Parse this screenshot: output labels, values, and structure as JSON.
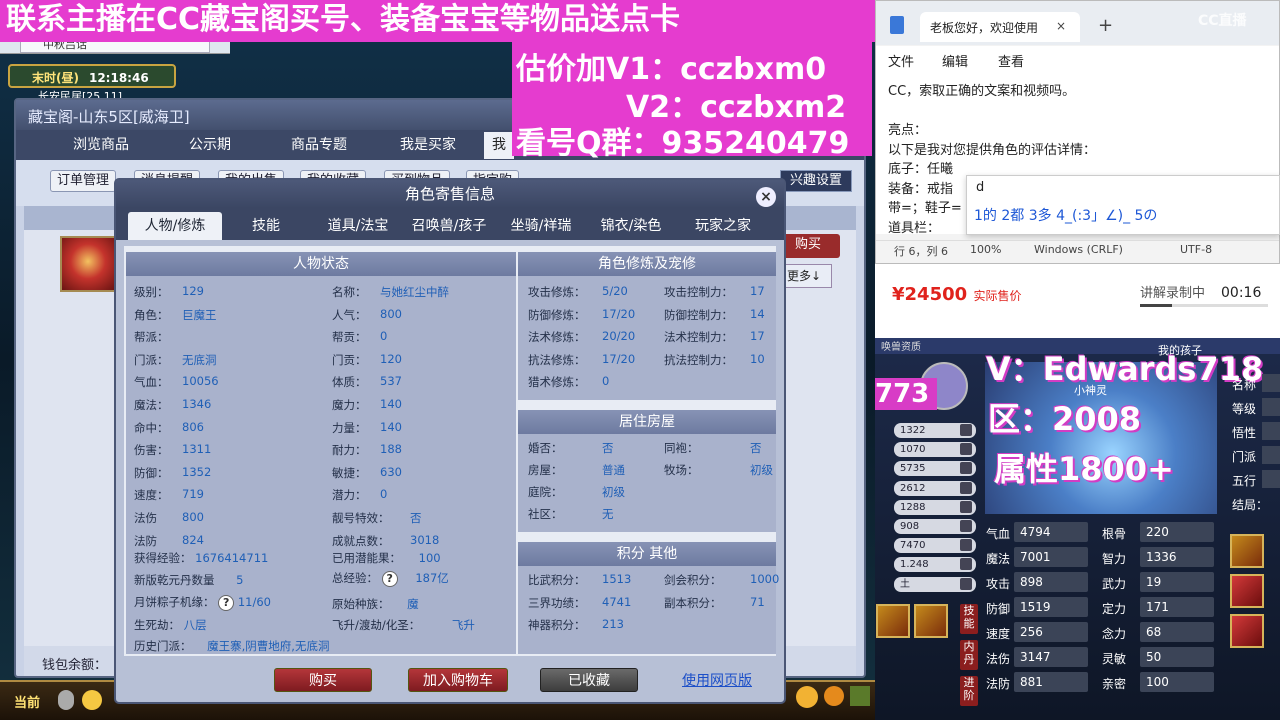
{
  "overlay": {
    "banner_top": "联系主播在CC藏宝阁买号、装备宝宝等物品送点卡",
    "line_v1": "估价加V1：cczbxm0",
    "line_v2": "V2：cczbxm2",
    "line_qq": "看号Q群：935240479"
  },
  "game": {
    "tab_label": "中秋吕话",
    "clock_label": "末时(昼)",
    "clock_time": "12:18:46",
    "map_name": "长安民居[25,11]",
    "current_label": "当前"
  },
  "treasure": {
    "title": "藏宝阁-山东5区[威海卫]",
    "tabs": [
      "浏览商品",
      "公示期",
      "商品专题",
      "我是买家",
      "我"
    ],
    "sub_buttons": [
      "订单管理",
      "消息提醒",
      "我的出售",
      "我的收藏",
      "买到物品",
      "指定购"
    ],
    "fav_settings": "兴趣设置",
    "side_buy": "购买",
    "side_more": "更多↓",
    "wallet_label": "钱包余额："
  },
  "role_dialog": {
    "title": "角色寄售信息",
    "tabs": [
      "人物/修炼",
      "技能",
      "道具/法宝",
      "召唤兽/孩子",
      "坐骑/祥瑞",
      "锦衣/染色",
      "玩家之家"
    ],
    "status_title": "人物状态",
    "status_left": [
      {
        "k": "级别：",
        "v": "129"
      },
      {
        "k": "角色：",
        "v": "巨魔王"
      },
      {
        "k": "帮派：",
        "v": ""
      },
      {
        "k": "门派：",
        "v": "无底洞"
      },
      {
        "k": "气血：",
        "v": "10056"
      },
      {
        "k": "魔法：",
        "v": "1346"
      },
      {
        "k": "命中：",
        "v": "806"
      },
      {
        "k": "伤害：",
        "v": "1311"
      },
      {
        "k": "防御：",
        "v": "1352"
      },
      {
        "k": "速度：",
        "v": "719"
      },
      {
        "k": "法伤",
        "v": "800"
      },
      {
        "k": "法防",
        "v": "824"
      }
    ],
    "status_right": [
      {
        "k": "名称：",
        "v": "与她红尘中醉"
      },
      {
        "k": "人气：",
        "v": "800"
      },
      {
        "k": "帮贡：",
        "v": "0"
      },
      {
        "k": "门贡：",
        "v": "120"
      },
      {
        "k": "体质：",
        "v": "537"
      },
      {
        "k": "魔力：",
        "v": "140"
      },
      {
        "k": "力量：",
        "v": "140"
      },
      {
        "k": "耐力：",
        "v": "188"
      },
      {
        "k": "敏捷：",
        "v": "630"
      },
      {
        "k": "潜力：",
        "v": "0"
      },
      {
        "k": "靓号特效：",
        "v": "否"
      },
      {
        "k": "成就点数：",
        "v": "3018"
      }
    ],
    "extra": {
      "exp_k": "获得经验：",
      "exp_v": "1676414711",
      "potential_k": "已用潜能果：",
      "potential_v": "100",
      "yuandan_k": "新版乾元丹数量",
      "yuandan_v": "5",
      "total_exp_k": "总经验：",
      "total_exp_v": "187亿",
      "mooncake_k": "月饼粽子机缘：",
      "mooncake_v": "11/60",
      "race_k": "原始种族：",
      "race_v": "魔",
      "life_k": "生死劫：",
      "life_v": "八层",
      "fly_k": "飞升/渡劫/化圣：",
      "fly_v": "飞升",
      "history_k": "历史门派：",
      "history_v": "魔王寨,阴曹地府,无底洞",
      "q_mark": "?"
    },
    "cultivation_title": "角色修炼及宠修",
    "cultivation": [
      {
        "k": "攻击修炼：",
        "v": "5/20",
        "k2": "攻击控制力：",
        "v2": "17"
      },
      {
        "k": "防御修炼：",
        "v": "17/20",
        "k2": "防御控制力：",
        "v2": "14"
      },
      {
        "k": "法术修炼：",
        "v": "20/20",
        "k2": "法术控制力：",
        "v2": "17"
      },
      {
        "k": "抗法修炼：",
        "v": "17/20",
        "k2": "抗法控制力：",
        "v2": "10"
      },
      {
        "k": "猎术修炼：",
        "v": "0",
        "k2": "",
        "v2": ""
      }
    ],
    "house_title": "居住房屋",
    "house": [
      {
        "k": "婚否：",
        "v": "否",
        "k2": "同袍：",
        "v2": "否"
      },
      {
        "k": "房屋：",
        "v": "普通",
        "k2": "牧场：",
        "v2": "初级"
      },
      {
        "k": "庭院：",
        "v": "初级",
        "k2": "",
        "v2": ""
      },
      {
        "k": "社区：",
        "v": "无",
        "k2": "",
        "v2": ""
      }
    ],
    "score_title": "积分 其他",
    "score": [
      {
        "k": "比武积分：",
        "v": "1513",
        "k2": "剑会积分：",
        "v2": "1000"
      },
      {
        "k": "三界功绩：",
        "v": "4741",
        "k2": "副本积分：",
        "v2": "71"
      },
      {
        "k": "神器积分：",
        "v": "213",
        "k2": "",
        "v2": ""
      }
    ],
    "buttons": {
      "buy": "购买",
      "cart": "加入购物车",
      "collected": "已收藏",
      "web": "使用网页版"
    }
  },
  "notepad": {
    "tab_title": "老板您好，欢迎使用",
    "close": "×",
    "plus": "+",
    "menu": [
      "文件",
      "编辑",
      "查看"
    ],
    "lines": [
      "CC，索取正确的文案和视频吗。",
      "",
      "亮点：",
      "以下是我对您提供角色的评估详情：",
      "底子：任曦",
      "装备：戒指",
      "带=；鞋子=",
      "道具栏："
    ],
    "ime_input": "d",
    "ime_candidates": "1的  2都  3多  4_(:3」∠)_  5の",
    "status": [
      "行 6，列 6",
      "100%",
      "Windows (CRLF)",
      "UTF-8"
    ],
    "watermark_small": "CC直播"
  },
  "price_bar": {
    "price": "¥24500",
    "price_note": "实际售价",
    "recording_label": "讲解录制中",
    "recording_time": "00:16",
    "recording_progress": 0.25
  },
  "right_game": {
    "title": "唤兽资质",
    "pet_name": "小神灵",
    "header_text": "我的孩子",
    "badge_773": "773",
    "big_v": "V：Edwards718",
    "big_qu": "区：2008",
    "big_attr": "属性1800+",
    "stats": [
      "1322",
      "1070",
      "5735",
      "2612",
      "1288",
      "908",
      "7470",
      "1.248",
      "土"
    ],
    "attrs": [
      {
        "k": "气血",
        "v": "4794",
        "k2": "根骨",
        "v2": "220"
      },
      {
        "k": "魔法",
        "v": "7001",
        "k2": "智力",
        "v2": "1336"
      },
      {
        "k": "攻击",
        "v": "898",
        "k2": "武力",
        "v2": "19"
      },
      {
        "k": "防御",
        "v": "1519",
        "k2": "定力",
        "v2": "171"
      },
      {
        "k": "速度",
        "v": "256",
        "k2": "念力",
        "v2": "68"
      },
      {
        "k": "法伤",
        "v": "3147",
        "k2": "灵敏",
        "v2": "50"
      },
      {
        "k": "法防",
        "v": "881",
        "k2": "亲密",
        "v2": "100"
      }
    ],
    "side_labels": [
      "名称",
      "等级",
      "悟性",
      "门派",
      "五行",
      "结局："
    ],
    "vertical_btns": [
      "技能",
      "内丹",
      "进阶"
    ],
    "cc_logo": "CC直播"
  }
}
